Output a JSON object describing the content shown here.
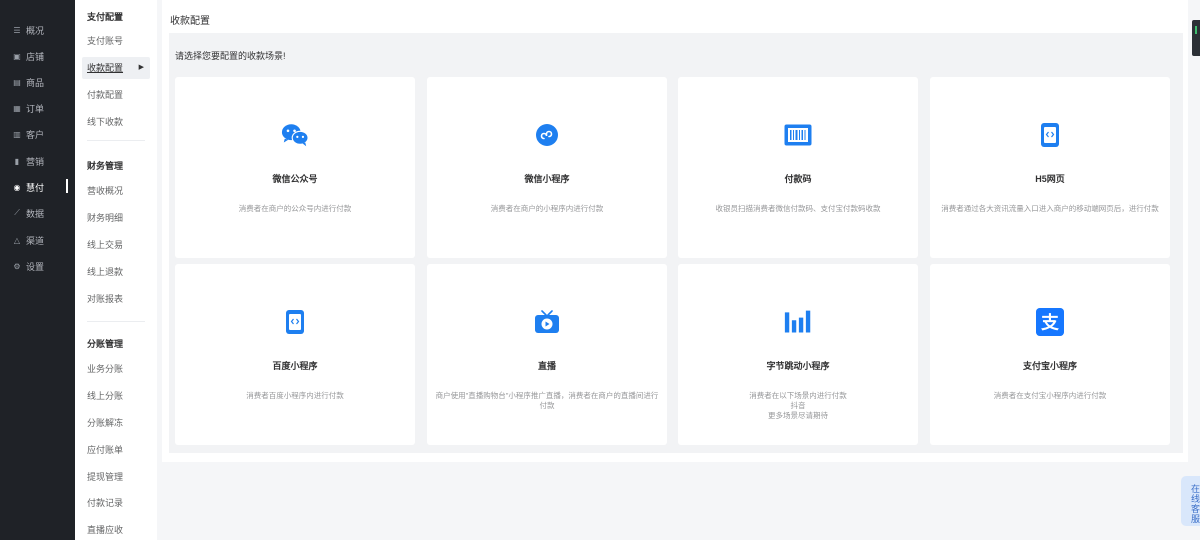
{
  "nav": {
    "items": [
      {
        "label": "概况",
        "icon": "dashboard-icon",
        "glyph": "☰"
      },
      {
        "label": "店铺",
        "icon": "store-icon",
        "glyph": "▣"
      },
      {
        "label": "商品",
        "icon": "goods-icon",
        "glyph": "▤"
      },
      {
        "label": "订单",
        "icon": "order-icon",
        "glyph": "▦"
      },
      {
        "label": "客户",
        "icon": "customer-icon",
        "glyph": "▥"
      },
      {
        "label": "营销",
        "icon": "marketing-icon",
        "glyph": "▮"
      },
      {
        "label": "慧付",
        "icon": "pay-icon",
        "glyph": "◉"
      },
      {
        "label": "数据",
        "icon": "data-icon",
        "glyph": "⟋"
      },
      {
        "label": "渠道",
        "icon": "channel-icon",
        "glyph": "△"
      },
      {
        "label": "设置",
        "icon": "settings-icon",
        "glyph": "⚙"
      }
    ],
    "active_index": 6
  },
  "subnav": {
    "group1": "支付配置",
    "group1_items": [
      "支付账号",
      "收款配置",
      "付款配置",
      "线下收款"
    ],
    "active_item": "收款配置",
    "group2": "财务管理",
    "group2_items": [
      "营收概况",
      "财务明细",
      "线上交易",
      "线上退款",
      "对账报表"
    ],
    "group3": "分账管理",
    "group3_items": [
      "业务分账",
      "线上分账",
      "分账解冻",
      "应付账单",
      "提现管理",
      "付款记录",
      "直播应收"
    ]
  },
  "main": {
    "breadcrumb": "收款配置",
    "prompt": "请选择您要配置的收款场景!",
    "cards": [
      {
        "title": "微信公众号",
        "desc": "消费者在商户的公众号内进行付款",
        "icon": "wechat-official-icon"
      },
      {
        "title": "微信小程序",
        "desc": "消费者在商户的小程序内进行付款",
        "icon": "wechat-miniprogram-icon"
      },
      {
        "title": "付款码",
        "desc": "收银员扫描消费者微信付款码、支付宝付款码收款",
        "icon": "barcode-scan-icon"
      },
      {
        "title": "H5网页",
        "desc": "消费者通过各大资讯流量入口进入商户的移动端网页后，进行付款",
        "icon": "h5-page-icon"
      },
      {
        "title": "百度小程序",
        "desc": "消费者百度小程序内进行付款",
        "icon": "baidu-miniprogram-icon"
      },
      {
        "title": "直播",
        "desc": "商户使用\"直播购物台\"小程序推广直播，消费者在商户的直播间进行付款",
        "icon": "live-tv-icon"
      },
      {
        "title": "字节跳动小程序",
        "desc": "消费者在以下场景内进行付款\n抖音\n更多场景尽请期待",
        "icon": "bytedance-icon"
      },
      {
        "title": "支付宝小程序",
        "desc": "消费者在支付宝小程序内进行付款",
        "icon": "alipay-icon"
      }
    ]
  },
  "kefu": {
    "label": "在线客服"
  },
  "colors": {
    "nav_bg": "#1f2227",
    "accent_blue": "#1e7ff0",
    "alipay_blue": "#1677ff",
    "panel_bg": "#f2f3f5"
  }
}
